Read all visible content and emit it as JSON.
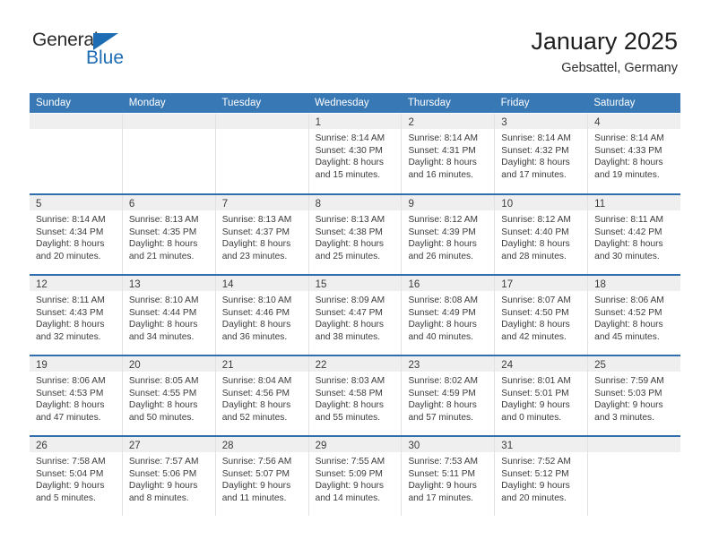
{
  "brand": {
    "name_top": "General",
    "name_bottom": "Blue",
    "accent_color": "#1d6cb4"
  },
  "header": {
    "title": "January 2025",
    "subtitle": "Gebsattel, Germany"
  },
  "theme": {
    "header_row_bg": "#3878b4",
    "week_divider": "#2f6fad",
    "day_band_bg": "#efefef",
    "page_bg": "#ffffff",
    "text_color": "#3b3b3b"
  },
  "weekdays": [
    "Sunday",
    "Monday",
    "Tuesday",
    "Wednesday",
    "Thursday",
    "Friday",
    "Saturday"
  ],
  "weeks": [
    [
      {
        "day": "",
        "empty": true,
        "lines": []
      },
      {
        "day": "",
        "empty": true,
        "lines": []
      },
      {
        "day": "",
        "empty": true,
        "lines": []
      },
      {
        "day": "1",
        "empty": false,
        "lines": [
          "Sunrise: 8:14 AM",
          "Sunset: 4:30 PM",
          "Daylight: 8 hours",
          "and 15 minutes."
        ]
      },
      {
        "day": "2",
        "empty": false,
        "lines": [
          "Sunrise: 8:14 AM",
          "Sunset: 4:31 PM",
          "Daylight: 8 hours",
          "and 16 minutes."
        ]
      },
      {
        "day": "3",
        "empty": false,
        "lines": [
          "Sunrise: 8:14 AM",
          "Sunset: 4:32 PM",
          "Daylight: 8 hours",
          "and 17 minutes."
        ]
      },
      {
        "day": "4",
        "empty": false,
        "lines": [
          "Sunrise: 8:14 AM",
          "Sunset: 4:33 PM",
          "Daylight: 8 hours",
          "and 19 minutes."
        ]
      }
    ],
    [
      {
        "day": "5",
        "empty": false,
        "lines": [
          "Sunrise: 8:14 AM",
          "Sunset: 4:34 PM",
          "Daylight: 8 hours",
          "and 20 minutes."
        ]
      },
      {
        "day": "6",
        "empty": false,
        "lines": [
          "Sunrise: 8:13 AM",
          "Sunset: 4:35 PM",
          "Daylight: 8 hours",
          "and 21 minutes."
        ]
      },
      {
        "day": "7",
        "empty": false,
        "lines": [
          "Sunrise: 8:13 AM",
          "Sunset: 4:37 PM",
          "Daylight: 8 hours",
          "and 23 minutes."
        ]
      },
      {
        "day": "8",
        "empty": false,
        "lines": [
          "Sunrise: 8:13 AM",
          "Sunset: 4:38 PM",
          "Daylight: 8 hours",
          "and 25 minutes."
        ]
      },
      {
        "day": "9",
        "empty": false,
        "lines": [
          "Sunrise: 8:12 AM",
          "Sunset: 4:39 PM",
          "Daylight: 8 hours",
          "and 26 minutes."
        ]
      },
      {
        "day": "10",
        "empty": false,
        "lines": [
          "Sunrise: 8:12 AM",
          "Sunset: 4:40 PM",
          "Daylight: 8 hours",
          "and 28 minutes."
        ]
      },
      {
        "day": "11",
        "empty": false,
        "lines": [
          "Sunrise: 8:11 AM",
          "Sunset: 4:42 PM",
          "Daylight: 8 hours",
          "and 30 minutes."
        ]
      }
    ],
    [
      {
        "day": "12",
        "empty": false,
        "lines": [
          "Sunrise: 8:11 AM",
          "Sunset: 4:43 PM",
          "Daylight: 8 hours",
          "and 32 minutes."
        ]
      },
      {
        "day": "13",
        "empty": false,
        "lines": [
          "Sunrise: 8:10 AM",
          "Sunset: 4:44 PM",
          "Daylight: 8 hours",
          "and 34 minutes."
        ]
      },
      {
        "day": "14",
        "empty": false,
        "lines": [
          "Sunrise: 8:10 AM",
          "Sunset: 4:46 PM",
          "Daylight: 8 hours",
          "and 36 minutes."
        ]
      },
      {
        "day": "15",
        "empty": false,
        "lines": [
          "Sunrise: 8:09 AM",
          "Sunset: 4:47 PM",
          "Daylight: 8 hours",
          "and 38 minutes."
        ]
      },
      {
        "day": "16",
        "empty": false,
        "lines": [
          "Sunrise: 8:08 AM",
          "Sunset: 4:49 PM",
          "Daylight: 8 hours",
          "and 40 minutes."
        ]
      },
      {
        "day": "17",
        "empty": false,
        "lines": [
          "Sunrise: 8:07 AM",
          "Sunset: 4:50 PM",
          "Daylight: 8 hours",
          "and 42 minutes."
        ]
      },
      {
        "day": "18",
        "empty": false,
        "lines": [
          "Sunrise: 8:06 AM",
          "Sunset: 4:52 PM",
          "Daylight: 8 hours",
          "and 45 minutes."
        ]
      }
    ],
    [
      {
        "day": "19",
        "empty": false,
        "lines": [
          "Sunrise: 8:06 AM",
          "Sunset: 4:53 PM",
          "Daylight: 8 hours",
          "and 47 minutes."
        ]
      },
      {
        "day": "20",
        "empty": false,
        "lines": [
          "Sunrise: 8:05 AM",
          "Sunset: 4:55 PM",
          "Daylight: 8 hours",
          "and 50 minutes."
        ]
      },
      {
        "day": "21",
        "empty": false,
        "lines": [
          "Sunrise: 8:04 AM",
          "Sunset: 4:56 PM",
          "Daylight: 8 hours",
          "and 52 minutes."
        ]
      },
      {
        "day": "22",
        "empty": false,
        "lines": [
          "Sunrise: 8:03 AM",
          "Sunset: 4:58 PM",
          "Daylight: 8 hours",
          "and 55 minutes."
        ]
      },
      {
        "day": "23",
        "empty": false,
        "lines": [
          "Sunrise: 8:02 AM",
          "Sunset: 4:59 PM",
          "Daylight: 8 hours",
          "and 57 minutes."
        ]
      },
      {
        "day": "24",
        "empty": false,
        "lines": [
          "Sunrise: 8:01 AM",
          "Sunset: 5:01 PM",
          "Daylight: 9 hours",
          "and 0 minutes."
        ]
      },
      {
        "day": "25",
        "empty": false,
        "lines": [
          "Sunrise: 7:59 AM",
          "Sunset: 5:03 PM",
          "Daylight: 9 hours",
          "and 3 minutes."
        ]
      }
    ],
    [
      {
        "day": "26",
        "empty": false,
        "lines": [
          "Sunrise: 7:58 AM",
          "Sunset: 5:04 PM",
          "Daylight: 9 hours",
          "and 5 minutes."
        ]
      },
      {
        "day": "27",
        "empty": false,
        "lines": [
          "Sunrise: 7:57 AM",
          "Sunset: 5:06 PM",
          "Daylight: 9 hours",
          "and 8 minutes."
        ]
      },
      {
        "day": "28",
        "empty": false,
        "lines": [
          "Sunrise: 7:56 AM",
          "Sunset: 5:07 PM",
          "Daylight: 9 hours",
          "and 11 minutes."
        ]
      },
      {
        "day": "29",
        "empty": false,
        "lines": [
          "Sunrise: 7:55 AM",
          "Sunset: 5:09 PM",
          "Daylight: 9 hours",
          "and 14 minutes."
        ]
      },
      {
        "day": "30",
        "empty": false,
        "lines": [
          "Sunrise: 7:53 AM",
          "Sunset: 5:11 PM",
          "Daylight: 9 hours",
          "and 17 minutes."
        ]
      },
      {
        "day": "31",
        "empty": false,
        "lines": [
          "Sunrise: 7:52 AM",
          "Sunset: 5:12 PM",
          "Daylight: 9 hours",
          "and 20 minutes."
        ]
      },
      {
        "day": "",
        "empty": true,
        "lines": []
      }
    ]
  ]
}
